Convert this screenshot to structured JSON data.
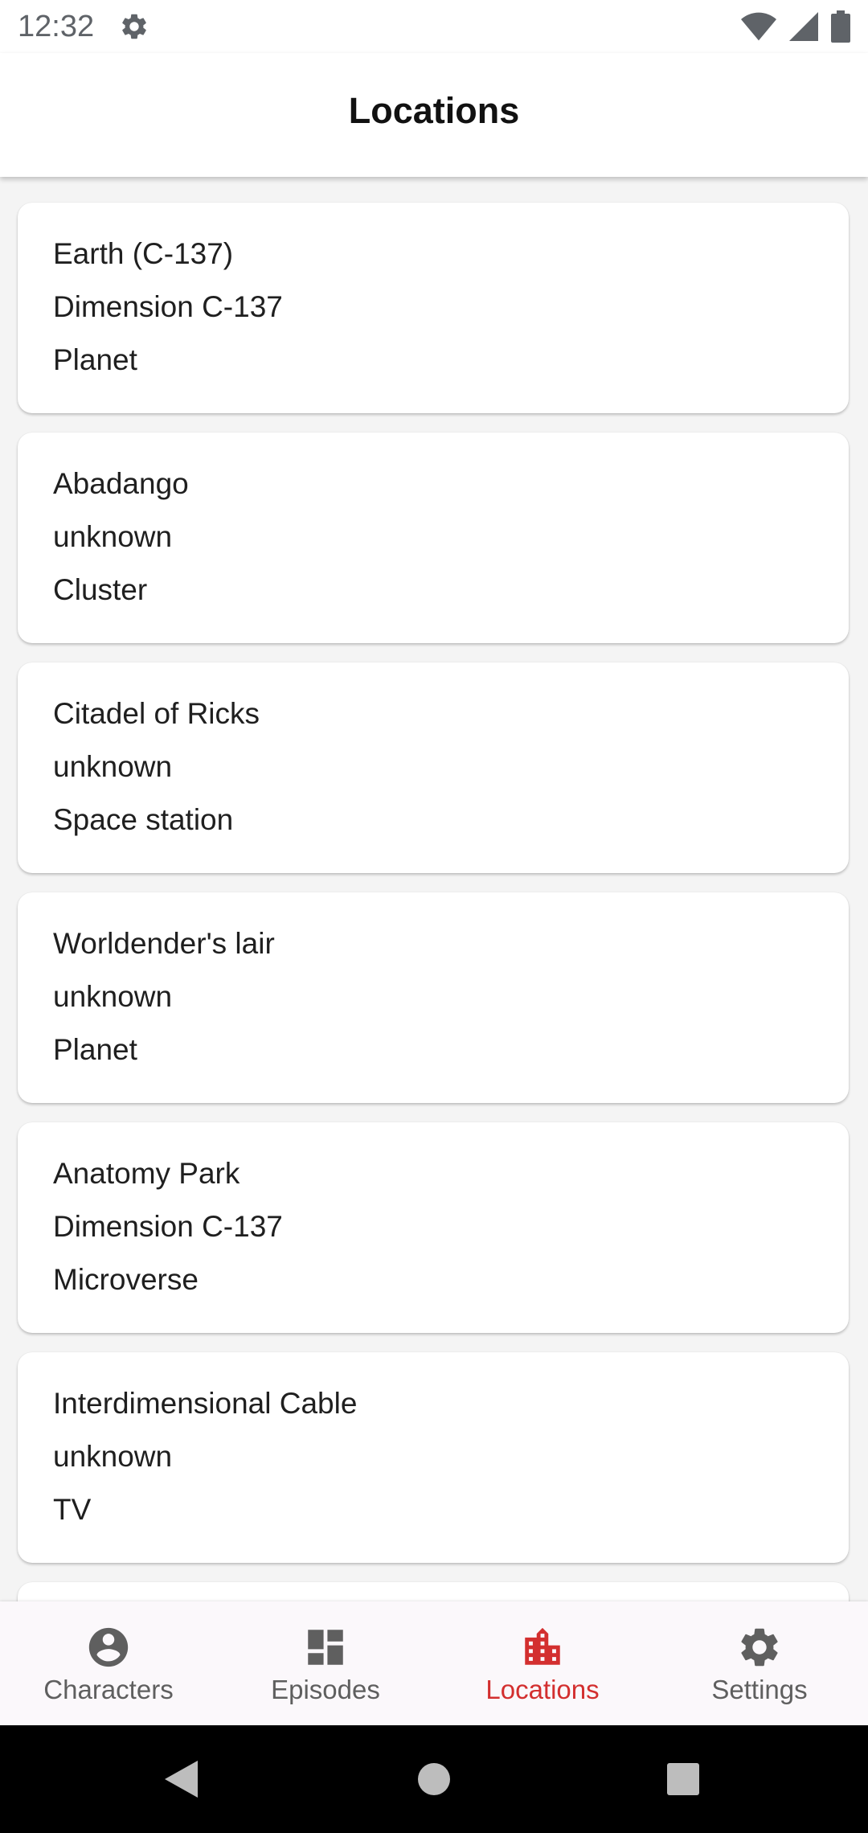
{
  "status_bar": {
    "time": "12:32",
    "icons": [
      "gear-icon",
      "wifi-icon",
      "signal-icon",
      "battery-icon"
    ]
  },
  "app_bar": {
    "title": "Locations"
  },
  "locations": [
    {
      "name": "Earth (C-137)",
      "dimension": "Dimension C-137",
      "type": "Planet"
    },
    {
      "name": "Abadango",
      "dimension": "unknown",
      "type": "Cluster"
    },
    {
      "name": "Citadel of Ricks",
      "dimension": "unknown",
      "type": "Space station"
    },
    {
      "name": "Worldender's lair",
      "dimension": "unknown",
      "type": "Planet"
    },
    {
      "name": "Anatomy Park",
      "dimension": "Dimension C-137",
      "type": "Microverse"
    },
    {
      "name": "Interdimensional Cable",
      "dimension": "unknown",
      "type": "TV"
    }
  ],
  "bottom_nav": {
    "active": "Locations",
    "active_color": "#d32f2f",
    "inactive_color": "#5f5f5f",
    "items": [
      {
        "label": "Characters",
        "icon": "account-circle-icon"
      },
      {
        "label": "Episodes",
        "icon": "dashboard-icon"
      },
      {
        "label": "Locations",
        "icon": "location-city-icon"
      },
      {
        "label": "Settings",
        "icon": "settings-gear-icon"
      }
    ]
  },
  "system_nav": {
    "icons": [
      "back-icon",
      "home-icon",
      "recents-icon"
    ]
  }
}
